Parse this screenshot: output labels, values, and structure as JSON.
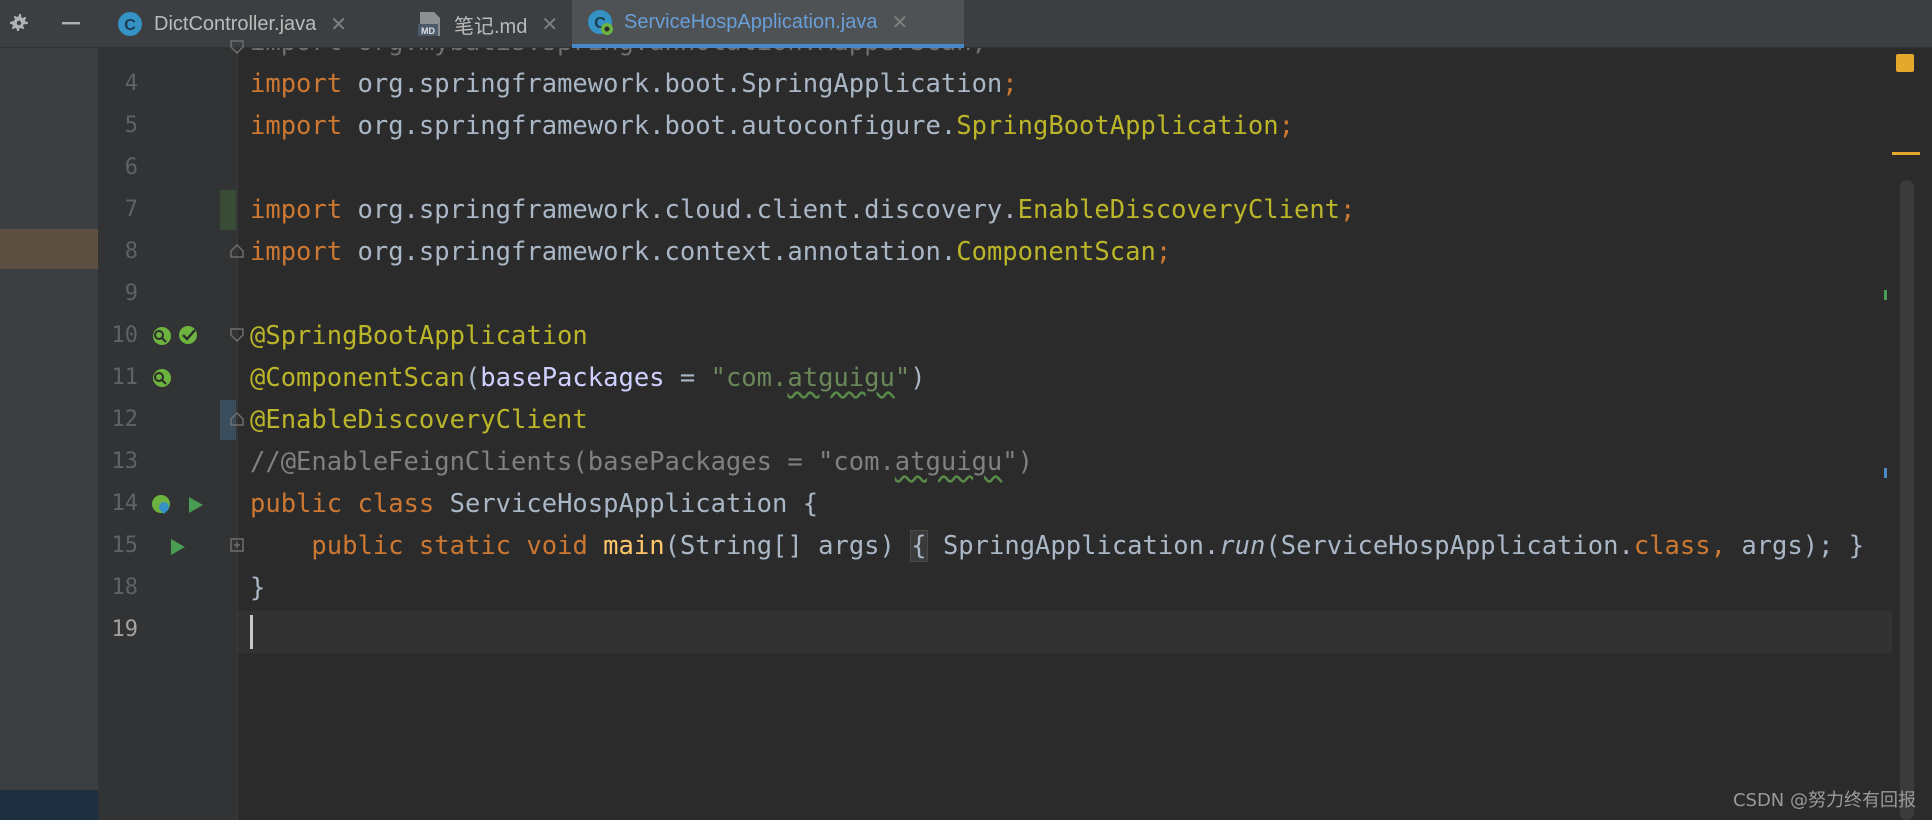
{
  "tabs": [
    {
      "label": "DictController.java",
      "icon": "java-class-icon",
      "active": false
    },
    {
      "label": "笔记.md",
      "icon": "markdown-file-icon",
      "active": false
    },
    {
      "label": "ServiceHospApplication.java",
      "icon": "spring-boot-class-icon",
      "active": true
    }
  ],
  "editor": {
    "partial_line": "import org.mybatis.spring.annotation.MapperScan;",
    "line_numbers": [
      "4",
      "5",
      "6",
      "7",
      "8",
      "9",
      "10",
      "11",
      "12",
      "13",
      "14",
      "15",
      "18",
      "19"
    ],
    "current_line": "19",
    "code": {
      "l4": {
        "kw": "import",
        "pkg": "org.springframework.boot.SpringApplication",
        "semi": ";"
      },
      "l5": {
        "kw": "import",
        "pkg": "org.springframework.boot.autoconfigure.",
        "cls": "SpringBootApplication",
        "semi": ";"
      },
      "l7": {
        "kw": "import",
        "pkg": "org.springframework.cloud.client.discovery.",
        "cls": "EnableDiscoveryClient",
        "semi": ";"
      },
      "l8": {
        "kw": "import",
        "pkg": "org.springframework.context.annotation.",
        "cls": "ComponentScan",
        "semi": ";"
      },
      "l10": {
        "ann": "@SpringBootApplication"
      },
      "l11": {
        "ann": "@ComponentScan",
        "open": "(",
        "param": "basePackages",
        "eq": " = ",
        "str1": "\"com.",
        "str2": "atguigu",
        "str3": "\"",
        "close": ")"
      },
      "l12": {
        "ann": "@EnableDiscoveryClient"
      },
      "l13": {
        "c1": "//@EnableFeignClients(basePackages = \"com.",
        "c2": "atguigu",
        "c3": "\")"
      },
      "l14": {
        "kw1": "public",
        "kw2": "class",
        "name": "ServiceHospApplication",
        "brace": " {"
      },
      "l15": {
        "kw1": "public",
        "kw2": "static",
        "kw3": "void",
        "fn": "main",
        "sig": "(String[] args) ",
        "lb": "{",
        "call1": " SpringApplication.",
        "run": "run",
        "call2": "(ServiceHospApplication.",
        "kwclass": "class",
        "comma": ", ",
        "args": "args);",
        "rb": " }"
      },
      "l18": {
        "text": "}"
      }
    }
  },
  "watermark": "CSDN @努力终有回报"
}
